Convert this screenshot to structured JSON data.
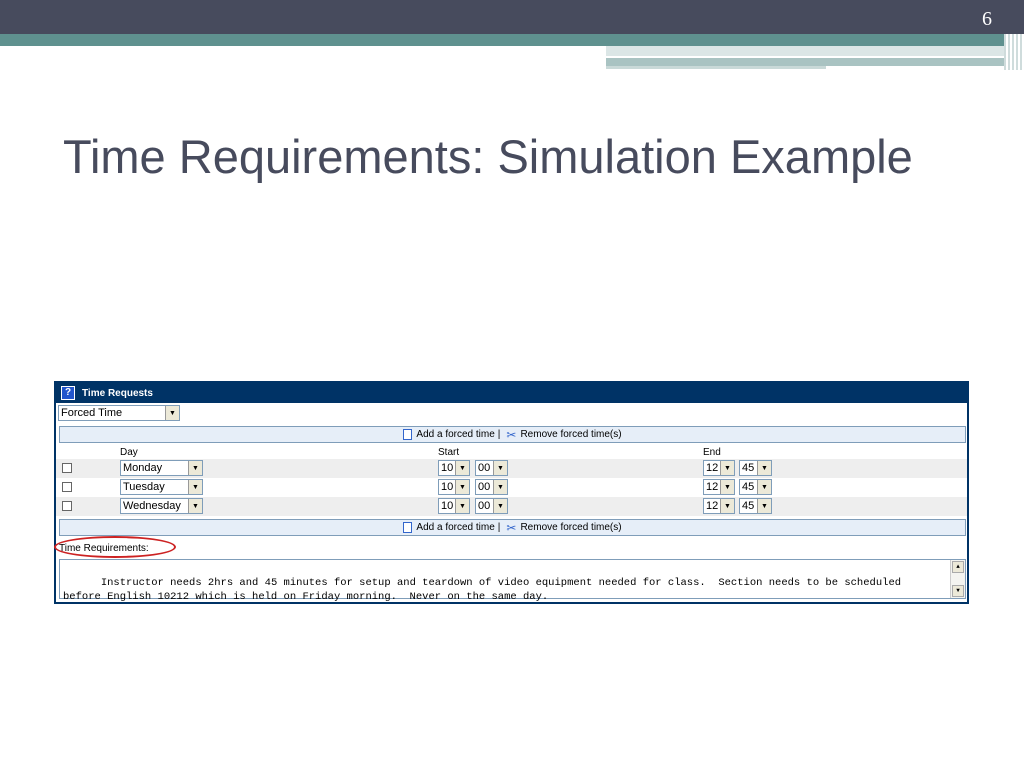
{
  "slide": {
    "number": "6",
    "title": "Time Requirements: Simulation Example"
  },
  "panel": {
    "header_title": "Time Requests",
    "help_icon_glyph": "?",
    "type_select": "Forced Time",
    "add_link": "Add a forced time",
    "separator": "|",
    "remove_link": "Remove forced time(s)",
    "columns": {
      "day": "Day",
      "start": "Start",
      "end": "End"
    },
    "rows": [
      {
        "day": "Monday",
        "start_hour": "10",
        "start_min": "00",
        "end_hour": "12",
        "end_min": "45"
      },
      {
        "day": "Tuesday",
        "start_hour": "10",
        "start_min": "00",
        "end_hour": "12",
        "end_min": "45"
      },
      {
        "day": "Wednesday",
        "start_hour": "10",
        "start_min": "00",
        "end_hour": "12",
        "end_min": "45"
      }
    ],
    "time_requirements_label": "Time Requirements:",
    "time_requirements_text": "Instructor needs 2hrs and 45 minutes for setup and teardown of video equipment needed for class.  Section needs to be scheduled\nbefore English 10212 which is held on Friday morning.  Never on the same day."
  },
  "colors": {
    "header_bar": "#474b5d",
    "teal_band": "#5f918f",
    "panel_header": "#003366",
    "highlight_oval": "#cc2222"
  }
}
